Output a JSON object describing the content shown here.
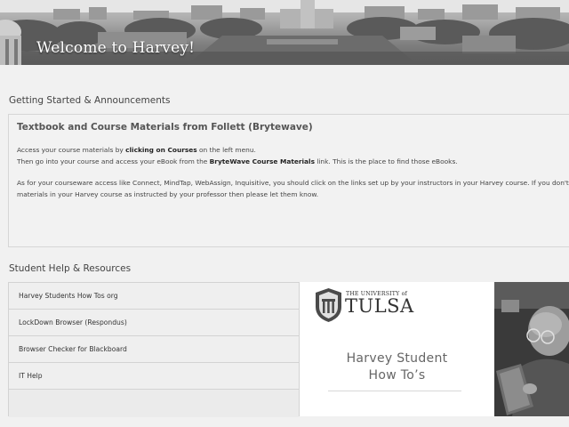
{
  "banner": {
    "title": "Welcome to Harvey!"
  },
  "getting_started": {
    "heading": "Getting Started & Announcements",
    "box_title": "Textbook and Course Materials from Follett (Brytewave)",
    "p1_a": "Access your course materials by ",
    "p1_b": "clicking on Courses",
    "p1_c": " on the left menu.",
    "p2_a": "Then go into your course and access your eBook from the ",
    "p2_b": "BryteWave Course Materials",
    "p2_c": " link. This is the place to find those eBooks.",
    "p3": "As for your courseware access like Connect, MindTap, WebAssign, Inquisitive, you should click on the links set up by your instructors in your Harvey course. If you don't see th",
    "p4": "materials in your Harvey course as instructed by your professor then please let them know."
  },
  "help": {
    "heading": "Student Help & Resources",
    "items": [
      {
        "label": "Harvey Students How Tos org"
      },
      {
        "label": "LockDown Browser (Respondus)"
      },
      {
        "label": "Browser Checker for Blackboard"
      },
      {
        "label": "IT Help"
      }
    ]
  },
  "promo": {
    "university_small": "THE UNIVERSITY of",
    "university_big": "TULSA",
    "caption_line1": "Harvey Student",
    "caption_line2": "How To’s"
  }
}
